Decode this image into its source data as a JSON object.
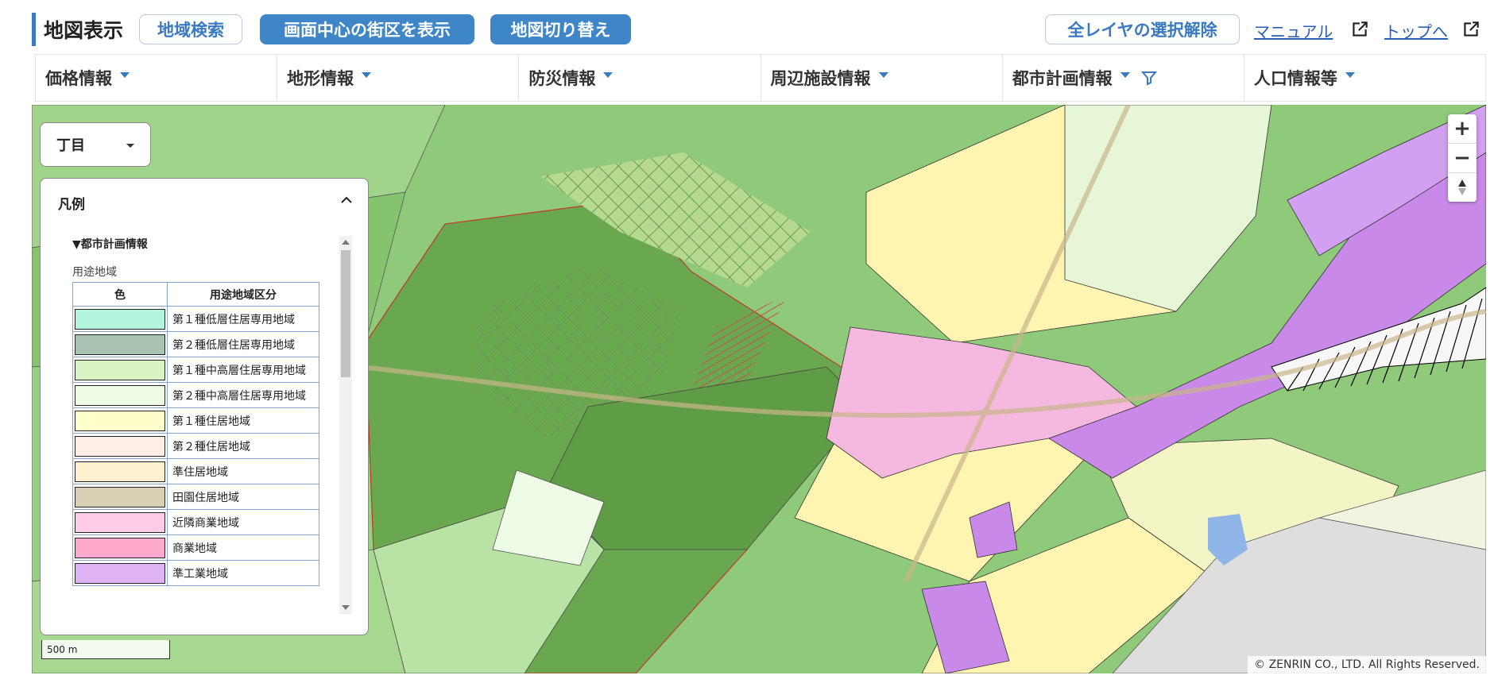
{
  "header": {
    "title": "地図表示",
    "buttons": {
      "region_search": "地域検索",
      "show_center_block": "画面中心の街区を表示",
      "switch_map": "地図切り替え",
      "clear_layers": "全レイヤの選択解除"
    },
    "links": {
      "manual": "マニュアル",
      "top": "トップへ"
    }
  },
  "categories": [
    {
      "label": "価格情報"
    },
    {
      "label": "地形情報"
    },
    {
      "label": "防災情報"
    },
    {
      "label": "周辺施設情報"
    },
    {
      "label": "都市計画情報",
      "filter_active": true
    },
    {
      "label": "人口情報等"
    }
  ],
  "map": {
    "area_select": "丁目",
    "zoom_in": "+",
    "zoom_out": "−",
    "scale": "500 m",
    "copyright": "© ZENRIN CO., LTD. All Rights Reserved."
  },
  "legend": {
    "title": "凡例",
    "section": "▼都市計画情報",
    "subsection": "用途地域",
    "col_color": "色",
    "col_zone": "用途地域区分",
    "rows": [
      {
        "color": "#b3f5dc",
        "name": "第１種低層住居専用地域"
      },
      {
        "color": "#a9c4b2",
        "name": "第２種低層住居専用地域"
      },
      {
        "color": "#d9f3c2",
        "name": "第１種中高層住居専用地域"
      },
      {
        "color": "#eefbe6",
        "name": "第２種中高層住居専用地域"
      },
      {
        "color": "#ffffcc",
        "name": "第１種住居地域"
      },
      {
        "color": "#ffeee6",
        "name": "第２種住居地域"
      },
      {
        "color": "#fff0d0",
        "name": "準住居地域"
      },
      {
        "color": "#d8cfb4",
        "name": "田園住居地域"
      },
      {
        "color": "#ffcce8",
        "name": "近隣商業地域"
      },
      {
        "color": "#ffaacc",
        "name": "商業地域"
      },
      {
        "color": "#e0b3f5",
        "name": "準工業地域"
      }
    ]
  }
}
